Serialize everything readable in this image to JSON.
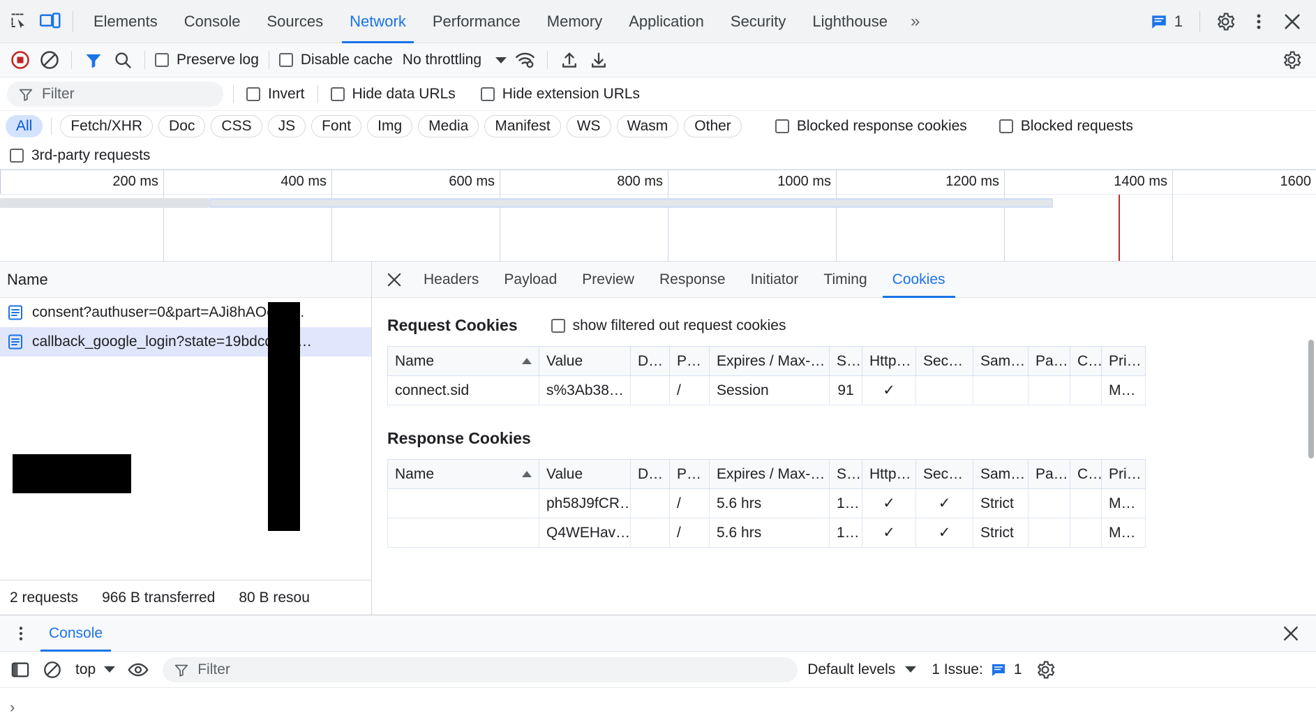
{
  "window": {
    "main_tabs": [
      {
        "label": "Elements",
        "active": false
      },
      {
        "label": "Console",
        "active": false
      },
      {
        "label": "Sources",
        "active": false
      },
      {
        "label": "Network",
        "active": true
      },
      {
        "label": "Performance",
        "active": false
      },
      {
        "label": "Memory",
        "active": false
      },
      {
        "label": "Application",
        "active": false
      },
      {
        "label": "Security",
        "active": false
      },
      {
        "label": "Lighthouse",
        "active": false
      }
    ],
    "more_tabs_glyph": "»",
    "issues_count": "1",
    "icons": {
      "inspect": "inspect-element-icon",
      "device": "device-toolbar-icon",
      "issues": "issues-message-icon",
      "settings": "gear-icon",
      "more": "more-vertical-icon",
      "close": "close-icon"
    }
  },
  "network_toolbar": {
    "record_tooltip": "record-button",
    "clear_tooltip": "clear-button",
    "filter_tooltip": "filter-button",
    "search_tooltip": "search-button",
    "preserve_log": "Preserve log",
    "disable_cache": "Disable cache",
    "throttling": "No throttling",
    "wifi_tooltip": "network-conditions-icon",
    "import_tooltip": "import-har-icon",
    "export_tooltip": "export-har-icon",
    "settings_tooltip": "network-settings-icon"
  },
  "filter_row": {
    "placeholder": "Filter",
    "invert": "Invert",
    "hide_data_urls": "Hide data URLs",
    "hide_extension_urls": "Hide extension URLs"
  },
  "type_filters": [
    {
      "label": "All",
      "active": true
    },
    {
      "label": "Fetch/XHR",
      "active": false
    },
    {
      "label": "Doc",
      "active": false
    },
    {
      "label": "CSS",
      "active": false
    },
    {
      "label": "JS",
      "active": false
    },
    {
      "label": "Font",
      "active": false
    },
    {
      "label": "Img",
      "active": false
    },
    {
      "label": "Media",
      "active": false
    },
    {
      "label": "Manifest",
      "active": false
    },
    {
      "label": "WS",
      "active": false
    },
    {
      "label": "Wasm",
      "active": false
    },
    {
      "label": "Other",
      "active": false
    }
  ],
  "extra_filters": {
    "blocked_response_cookies": "Blocked response cookies",
    "blocked_requests": "Blocked requests",
    "third_party_requests": "3rd-party requests"
  },
  "overview": {
    "ticks": [
      "200 ms",
      "400 ms",
      "600 ms",
      "800 ms",
      "1000 ms",
      "1200 ms",
      "1400 ms",
      "1600"
    ],
    "band_color": "#d4e0f2",
    "redline_color": "#b5312a"
  },
  "request_list": {
    "column_name": "Name",
    "rows": [
      {
        "name": "consent?authuser=0&part=AJi8hAOcd7…",
        "selected": false
      },
      {
        "name": "callback_google_login?state=19bdcd6b2…",
        "selected": true
      }
    ],
    "footer": {
      "requests": "2 requests",
      "transferred": "966 B transferred",
      "resources": "80 B resou"
    }
  },
  "detail": {
    "tabs": [
      {
        "label": "Headers",
        "active": false
      },
      {
        "label": "Payload",
        "active": false
      },
      {
        "label": "Preview",
        "active": false
      },
      {
        "label": "Response",
        "active": false
      },
      {
        "label": "Initiator",
        "active": false
      },
      {
        "label": "Timing",
        "active": false
      },
      {
        "label": "Cookies",
        "active": true
      }
    ],
    "request_section": {
      "title": "Request Cookies",
      "show_filtered_label": "show filtered out request cookies",
      "columns": [
        "Name",
        "Value",
        "D…",
        "P…",
        "Expires / Max-…",
        "S…",
        "Http…",
        "Sec…",
        "Sam…",
        "Pa…",
        "C…",
        "Pri…"
      ],
      "sorted_column": "Name",
      "rows": [
        {
          "name": "connect.sid",
          "value": "s%3Ab38…",
          "domain": "",
          "path": "/",
          "expires": "Session",
          "size": "91",
          "httponly": "✓",
          "secure": "",
          "samesite": "",
          "partition": "",
          "cross": "",
          "priority": "M…"
        }
      ]
    },
    "response_section": {
      "title": "Response Cookies",
      "columns": [
        "Name",
        "Value",
        "D…",
        "P…",
        "Expires / Max-…",
        "S…",
        "Http…",
        "Sec…",
        "Sam…",
        "Pa…",
        "C…",
        "Pri…"
      ],
      "sorted_column": "Name",
      "rows": [
        {
          "name": "",
          "value": "ph58J9fCR…",
          "domain": "",
          "path": "/",
          "expires": "5.6 hrs",
          "size": "1…",
          "httponly": "✓",
          "secure": "✓",
          "samesite": "Strict",
          "partition": "",
          "cross": "",
          "priority": "M…"
        },
        {
          "name": "",
          "value": "Q4WEHav…",
          "domain": "",
          "path": "/",
          "expires": "5.6 hrs",
          "size": "1…",
          "httponly": "✓",
          "secure": "✓",
          "samesite": "Strict",
          "partition": "",
          "cross": "",
          "priority": "M…"
        }
      ]
    }
  },
  "drawer": {
    "tab": "Console",
    "close_tooltip": "close-drawer-icon",
    "more_tooltip": "more-tools-icon",
    "sidebar_tooltip": "console-sidebar-icon",
    "clear_tooltip": "clear-console-icon",
    "context": "top",
    "eye_tooltip": "live-expression-icon",
    "filter_placeholder": "Filter",
    "levels": "Default levels",
    "issues_label": "1 Issue:",
    "issues_count": "1",
    "settings_tooltip": "console-settings-icon",
    "prompt": "›"
  },
  "colors": {
    "accent": "#1a73e8",
    "active_pill_bg": "#d3e3fd",
    "active_pill_fg": "#0b57d0",
    "selected_row": "#e0e6fb",
    "toolbar_bg": "#f1f3f4",
    "panel_bg": "#f8f9fb",
    "record_red": "#c5221f"
  }
}
